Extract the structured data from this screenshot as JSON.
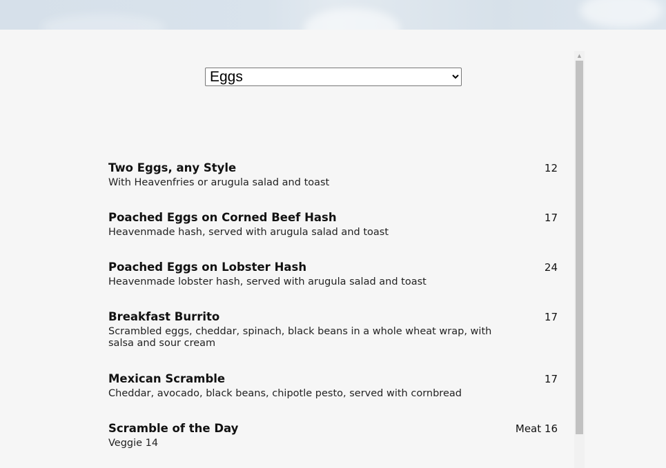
{
  "category_select": {
    "selected": "Eggs",
    "options": [
      "Eggs"
    ]
  },
  "menu_items": [
    {
      "name": "Two Eggs, any Style",
      "price": "12",
      "description": "With Heavenfries or arugula salad and toast"
    },
    {
      "name": "Poached Eggs on Corned Beef Hash",
      "price": "17",
      "description": "Heavenmade hash, served with arugula salad and toast"
    },
    {
      "name": "Poached Eggs on Lobster Hash",
      "price": "24",
      "description": "Heavenmade lobster hash, served with arugula salad and toast"
    },
    {
      "name": "Breakfast Burrito",
      "price": "17",
      "description": "Scrambled eggs, cheddar, spinach, black beans in a whole wheat wrap, with salsa and sour cream"
    },
    {
      "name": "Mexican Scramble",
      "price": "17",
      "description": "Cheddar, avocado, black beans, chipotle pesto, served with cornbread"
    },
    {
      "name": "Scramble of the Day",
      "price": "Meat 16",
      "description": "Veggie 14"
    }
  ],
  "scrollbar": {
    "up_arrow_icon": "triangle-up"
  }
}
